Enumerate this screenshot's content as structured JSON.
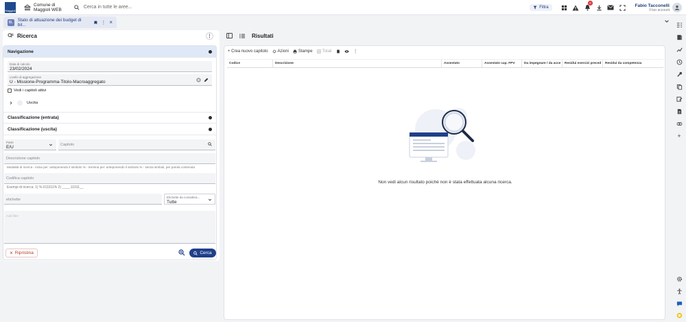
{
  "topbar": {
    "municipality": "Comune di",
    "app_name": "Maggioli WEB",
    "logo_text": "Maggioli",
    "search_placeholder": "Cerca in tutte le aree...",
    "filter_label": "Filtra",
    "notif_count": "0",
    "user_name": "Fabio Tacconelli",
    "user_sub": "Il tuo account"
  },
  "tab": {
    "icon_text": "BL",
    "title": "Stato di attuazione dei budget di bil..."
  },
  "left": {
    "title": "Ricerca",
    "sections": {
      "navigazione": "Navigazione",
      "class_entrata": "Classificazione (entrata)",
      "class_uscita": "Classificazione (uscita)"
    },
    "data_calcolo_label": "Data di calcolo",
    "data_calcolo_value": "23/02/2024",
    "livello_label": "Livello di aggregazione",
    "livello_value": "U - Missione-Programma-Titolo-Macroaggregato",
    "vedi_capitoli": "Vedi i capitoli attivi",
    "tree_item": "Uscita",
    "parte_label": "Parte",
    "parte_value": "E/U",
    "capitolo_placeholder": "Capitolo",
    "descrizione_placeholder": "Descrizione capitolo",
    "descrizione_hint": "Modalità di ricerca - inizia per: anteponendo il simbolo % - termina per: anteponendo il simbolo % - senza simboli, per parola contenuta",
    "codifica_placeholder": "Codifica capitolo",
    "codifica_hint": "Esempi di ricerca: 1) %.011011% 2) ____.11011__",
    "etichette_placeholder": "etichette",
    "etichette_consider_label": "Etichette da considera...",
    "etichette_consider_value": "Tutte",
    "add_filter_placeholder": "Add filter",
    "ripristina": "Ripristina",
    "cerca": "Cerca"
  },
  "right": {
    "title": "Risultati",
    "toolbar": {
      "crea": "Crea nuovo capitolo",
      "azioni": "Azioni",
      "stampe": "Stampe",
      "totali": "Totali"
    },
    "columns": [
      "Codice",
      "Descrizione",
      "Assestato",
      "Assestato cap. FPV",
      "Da impegnare / da acce",
      "Residui esercizi preced",
      "Residui da competenza"
    ],
    "empty_message": "Non vedi alcun risultato poichè non è stata effettuata alcuna ricerca."
  },
  "colors": {
    "primary": "#1f3f8a",
    "active_section": "#dfe8f7",
    "danger": "#c0392b",
    "badge": "#d33333"
  },
  "icons": {
    "rail": [
      "panel-icon",
      "book-icon",
      "trend-icon",
      "history-icon",
      "tool-icon",
      "copy-icon",
      "edit-icon",
      "document-icon",
      "link-icon",
      "plus-icon",
      "settings-icon",
      "accessibility-icon",
      "chat-icon",
      "help-icon"
    ]
  }
}
